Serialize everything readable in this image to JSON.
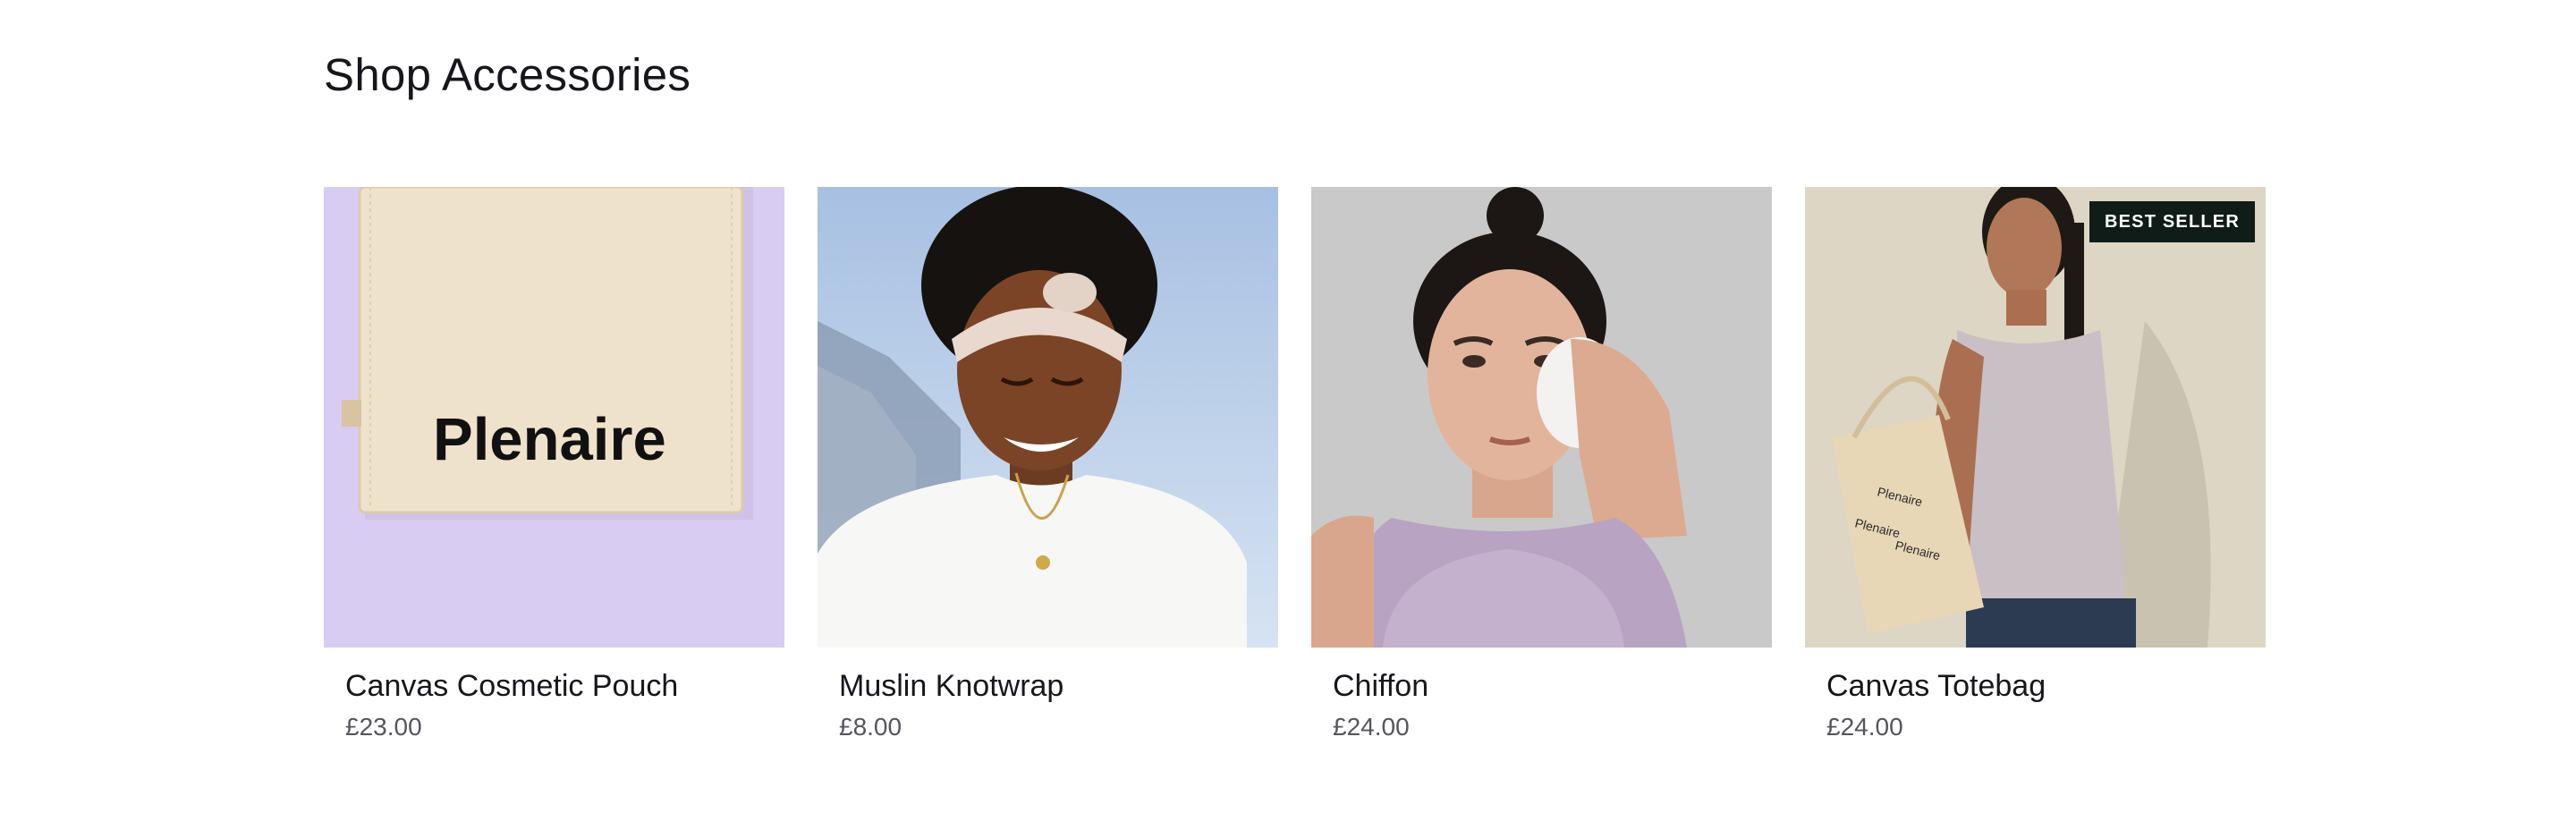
{
  "section": {
    "title": "Shop Accessories"
  },
  "products": [
    {
      "name": "Canvas Cosmetic Pouch",
      "price": "£23.00",
      "image_icon": "cosmetic-pouch-image",
      "bag_logo": "Plenaire"
    },
    {
      "name": "Muslin Knotwrap",
      "price": "£8.00",
      "image_icon": "knotwrap-model-image"
    },
    {
      "name": "Chiffon",
      "price": "£24.00",
      "image_icon": "chiffon-model-image"
    },
    {
      "name": "Canvas Totebag",
      "price": "£24.00",
      "image_icon": "totebag-model-image",
      "badge": "BEST SELLER"
    }
  ],
  "colors": {
    "pouch_bg": "#d9ccf3",
    "pouch_fabric": "#efe2cb",
    "sky": "#aec6e4",
    "studio_grey": "#c9c9c9",
    "tote_bg": "#ddd6c4",
    "badge_bg": "#0f1c18"
  }
}
